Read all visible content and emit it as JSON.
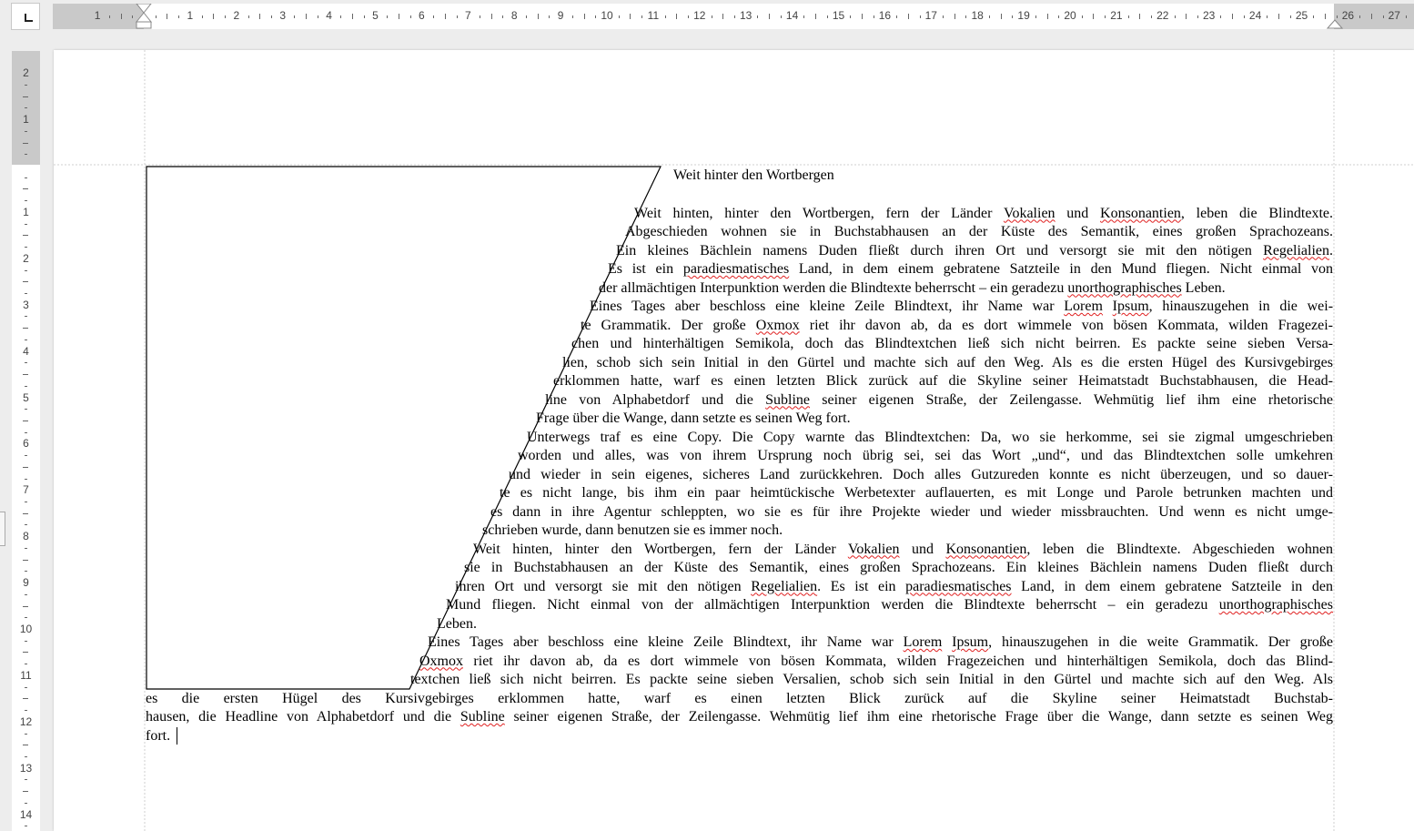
{
  "rulers": {
    "horizontal_numbers": [
      "1",
      "1",
      "2",
      "3",
      "4",
      "5",
      "6",
      "7",
      "8",
      "9",
      "10",
      "11",
      "12",
      "13",
      "14",
      "15",
      "16",
      "17",
      "18",
      "19",
      "20",
      "21",
      "22",
      "23",
      "24",
      "25",
      "26",
      "27"
    ],
    "vertical_numbers": [
      "2",
      "1",
      "1",
      "2",
      "3",
      "4",
      "5",
      "6",
      "7",
      "8",
      "9",
      "10",
      "11",
      "12",
      "13",
      "14"
    ]
  },
  "document": {
    "heading": "Weit hinter den Wortbergen",
    "lines": [
      [
        {
          "t": "Weit hinten, hinter den Wortbergen, fern der Länder "
        },
        {
          "t": "Vokalien",
          "s": true
        },
        {
          "t": " und "
        },
        {
          "t": "Konsonantien",
          "s": true
        },
        {
          "t": ", leben die Blindtexte."
        }
      ],
      [
        {
          "t": "Abgeschieden wohnen sie in Buchstabhausen an der Küste des Semantik, eines großen Sprachozeans."
        }
      ],
      [
        {
          "t": "Ein kleines Bächlein namens Duden fließt durch ihren Ort und versorgt sie mit den nötigen "
        },
        {
          "t": "Regelialien",
          "s": true
        },
        {
          "t": "."
        }
      ],
      [
        {
          "t": "Es ist ein "
        },
        {
          "t": "paradiesmatisches",
          "s": true
        },
        {
          "t": " Land, in dem einem gebratene Satzteile in den Mund fliegen. Nicht einmal von"
        }
      ],
      [
        {
          "t": "der allmächtigen Interpunktion werden die Blindtexte beherrscht – ein geradezu "
        },
        {
          "t": "unorthographisches",
          "s": true
        },
        {
          "t": " Leben."
        }
      ],
      [
        {
          "t": "Eines Tages aber beschloss eine kleine Zeile Blindtext, ihr Name war "
        },
        {
          "t": "Lorem",
          "s": true
        },
        {
          "t": " "
        },
        {
          "t": "Ipsum",
          "s": true
        },
        {
          "t": ", hinauszugehen in die wei-"
        }
      ],
      [
        {
          "t": "te Grammatik. Der große "
        },
        {
          "t": "Oxmox",
          "s": true
        },
        {
          "t": " riet ihr davon ab, da es dort wimmele von bösen Kommata, wilden Fragezei-"
        }
      ],
      [
        {
          "t": "chen und hinterhältigen Semikola, doch das Blindtextchen ließ sich nicht beirren. Es packte seine sieben Versa-"
        }
      ],
      [
        {
          "t": "lien, schob sich sein Initial in den Gürtel und machte sich auf den Weg. Als es die ersten Hügel des Kursivgebirges"
        }
      ],
      [
        {
          "t": "erklommen hatte, warf es einen letzten Blick zurück auf die Skyline seiner Heimatstadt Buchstabhausen, die Head-"
        }
      ],
      [
        {
          "t": "line von Alphabetdorf und die "
        },
        {
          "t": "Subline",
          "s": true
        },
        {
          "t": " seiner eigenen Straße, der Zeilengasse. Wehmütig lief ihm eine rhetorische"
        }
      ],
      [
        {
          "t": "Frage über die Wange, dann setzte es seinen Weg fort."
        }
      ],
      [
        {
          "t": "Unterwegs traf es eine Copy. Die Copy warnte das Blindtextchen: Da, wo sie herkomme, sei sie zigmal umgeschrieben"
        }
      ],
      [
        {
          "t": "worden und alles, was von ihrem Ursprung noch übrig sei, sei das Wort „und“, und das Blindtextchen solle umkehren"
        }
      ],
      [
        {
          "t": "und wieder in sein eigenes, sicheres Land zurückkehren. Doch alles Gutzureden konnte es nicht überzeugen, und so dauer-"
        }
      ],
      [
        {
          "t": "te es nicht lange, bis ihm ein paar heimtückische Werbetexter auflauerten, es mit Longe und Parole betrunken machten und"
        }
      ],
      [
        {
          "t": "es dann in ihre Agentur schleppten, wo sie es für ihre Projekte wieder und wieder missbrauchten. Und wenn es nicht umge-"
        }
      ],
      [
        {
          "t": "schrieben wurde, dann benutzen sie es immer noch."
        }
      ],
      [
        {
          "t": "Weit hinten, hinter den Wortbergen, fern der Länder "
        },
        {
          "t": "Vokalien",
          "s": true
        },
        {
          "t": " und "
        },
        {
          "t": "Konsonantien",
          "s": true
        },
        {
          "t": ", leben die Blindtexte. Abgeschieden wohnen"
        }
      ],
      [
        {
          "t": "sie in Buchstabhausen an der Küste des Semantik, eines großen Sprachozeans. Ein kleines Bächlein namens Duden fließt durch"
        }
      ],
      [
        {
          "t": "ihren Ort und versorgt sie mit den nötigen "
        },
        {
          "t": "Regelialien",
          "s": true
        },
        {
          "t": ". Es ist ein "
        },
        {
          "t": "paradiesmatisches",
          "s": true
        },
        {
          "t": " Land, in dem einem gebratene Satzteile in den"
        }
      ],
      [
        {
          "t": "Mund fliegen. Nicht einmal von der allmächtigen Interpunktion werden die Blindtexte beherrscht – ein geradezu "
        },
        {
          "t": "unorthographisches",
          "s": true
        }
      ],
      [
        {
          "t": "Leben."
        }
      ],
      [
        {
          "t": "Eines Tages aber beschloss eine kleine Zeile Blindtext, ihr Name war "
        },
        {
          "t": "Lorem",
          "s": true
        },
        {
          "t": " "
        },
        {
          "t": "Ipsum",
          "s": true
        },
        {
          "t": ", hinauszugehen in die weite Grammatik. Der große"
        }
      ],
      [
        {
          "t": "Oxmox",
          "s": true
        },
        {
          "t": " riet ihr davon ab, da es dort wimmele von bösen Kommata, wilden Fragezeichen und hinterhältigen Semikola, doch das Blind-"
        }
      ],
      [
        {
          "t": "textchen ließ sich nicht beirren. Es packte seine sieben Versalien, schob sich sein Initial in den Gürtel und machte sich auf den Weg. Als"
        }
      ],
      [
        {
          "t": "es die ersten Hügel des Kursivgebirges erklommen hatte, warf es einen letzten Blick zurück auf die Skyline seiner Heimatstadt Buchstab-"
        }
      ],
      [
        {
          "t": "hausen, die Headline von Alphabetdorf und die "
        },
        {
          "t": "Subline",
          "s": true
        },
        {
          "t": " seiner eigenen Straße, der Zeilengasse. Wehmütig lief ihm eine rhetorische Frage über die Wange, dann setzte es seinen Weg"
        }
      ],
      [
        {
          "t": "fort."
        }
      ]
    ]
  }
}
